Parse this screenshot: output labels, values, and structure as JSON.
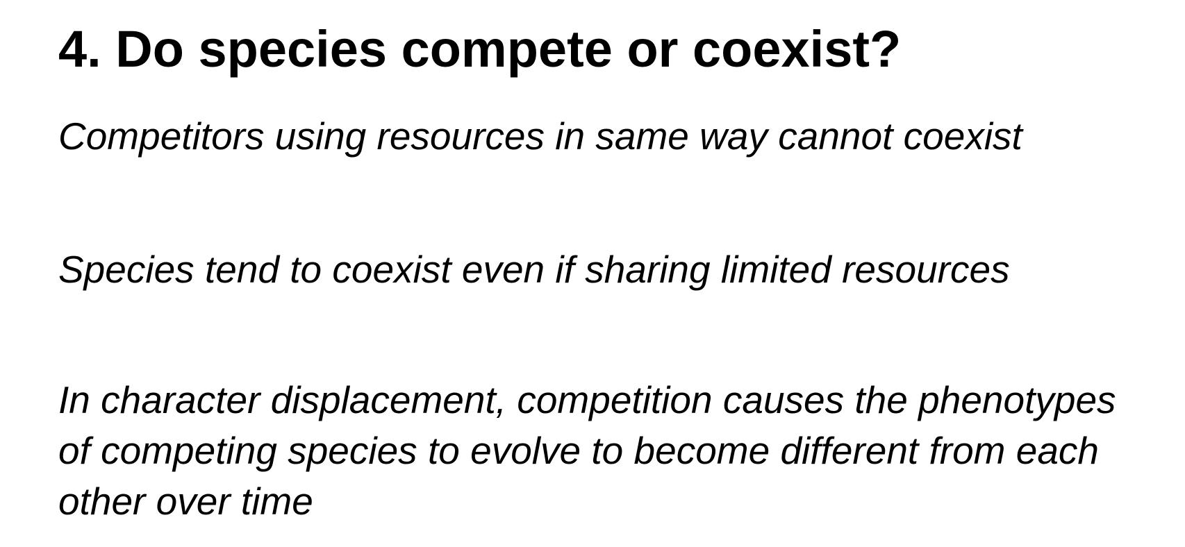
{
  "slide": {
    "title": "4. Do species compete or coexist?",
    "points": [
      "Competitors using resources in same way cannot coexist",
      "Species tend to coexist even if sharing limited resources",
      "In character displacement, competition causes the phenotypes of competing species to evolve to become different from each other over time"
    ]
  }
}
